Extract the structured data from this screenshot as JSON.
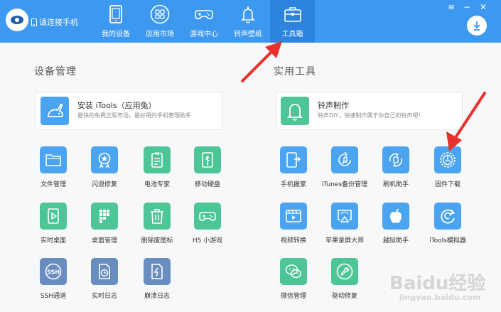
{
  "header": {
    "connect_label": "请连接手机",
    "tabs": [
      {
        "label": "我的设备"
      },
      {
        "label": "应用市场"
      },
      {
        "label": "游戏中心"
      },
      {
        "label": "铃声壁纸"
      },
      {
        "label": "工具箱",
        "active": true
      }
    ],
    "window_controls": {
      "menu": "≡",
      "minimize": "−",
      "close": "✕"
    }
  },
  "sections": {
    "device": {
      "title": "设备管理",
      "banner": {
        "title": "安装 iTools（应用兔）",
        "desc": "最快的免费正版市场，最好用的手机管理助手"
      },
      "tools": [
        {
          "label": "文件管理",
          "icon": "folder-icon"
        },
        {
          "label": "闪退修复",
          "icon": "badge-star-icon"
        },
        {
          "label": "电池专家",
          "icon": "battery-clipboard-icon"
        },
        {
          "label": "移动硬盘",
          "icon": "usb-drive-icon"
        },
        {
          "label": "实时桌面",
          "icon": "play-screen-icon"
        },
        {
          "label": "桌面管理",
          "icon": "grid-phone-icon"
        },
        {
          "label": "删除废图标",
          "icon": "trash-icon"
        },
        {
          "label": "H5 小游戏",
          "icon": "gamepad-icon"
        },
        {
          "label": "SSH通道",
          "icon": "ssh-icon"
        },
        {
          "label": "实时日志",
          "icon": "clock-doc-icon"
        },
        {
          "label": "崩溃日志",
          "icon": "crash-doc-icon"
        }
      ]
    },
    "utility": {
      "title": "实用工具",
      "banner": {
        "title": "铃声制作",
        "desc": "铃声DIY，快速制作属于你自己的铃声吧！"
      },
      "tools": [
        {
          "label": "手机搬家",
          "icon": "phone-transfer-icon"
        },
        {
          "label": "iTunes备份管理",
          "icon": "music-backup-icon"
        },
        {
          "label": "刷机助手",
          "icon": "flash-icon"
        },
        {
          "label": "固件下载",
          "icon": "firmware-gear-icon"
        },
        {
          "label": "视频转换",
          "icon": "video-icon"
        },
        {
          "label": "苹果录屏大师",
          "icon": "airplay-icon"
        },
        {
          "label": "越狱助手",
          "icon": "apple-icon"
        },
        {
          "label": "iTools模拟器",
          "icon": "emulator-icon"
        },
        {
          "label": "微信管理",
          "icon": "wechat-icon"
        },
        {
          "label": "驱动修复",
          "icon": "wrench-icon"
        }
      ]
    }
  },
  "watermark": {
    "brand": "Baidu经验",
    "url": "jingyan.baidu.com"
  },
  "colors": {
    "header": "#3d98f0",
    "header_active": "#2c84dc",
    "blue_tile": "#4ba4f0",
    "green_tile": "#4ec597",
    "slate_tile": "#6a8dbf",
    "arrow": "#e8312c"
  }
}
